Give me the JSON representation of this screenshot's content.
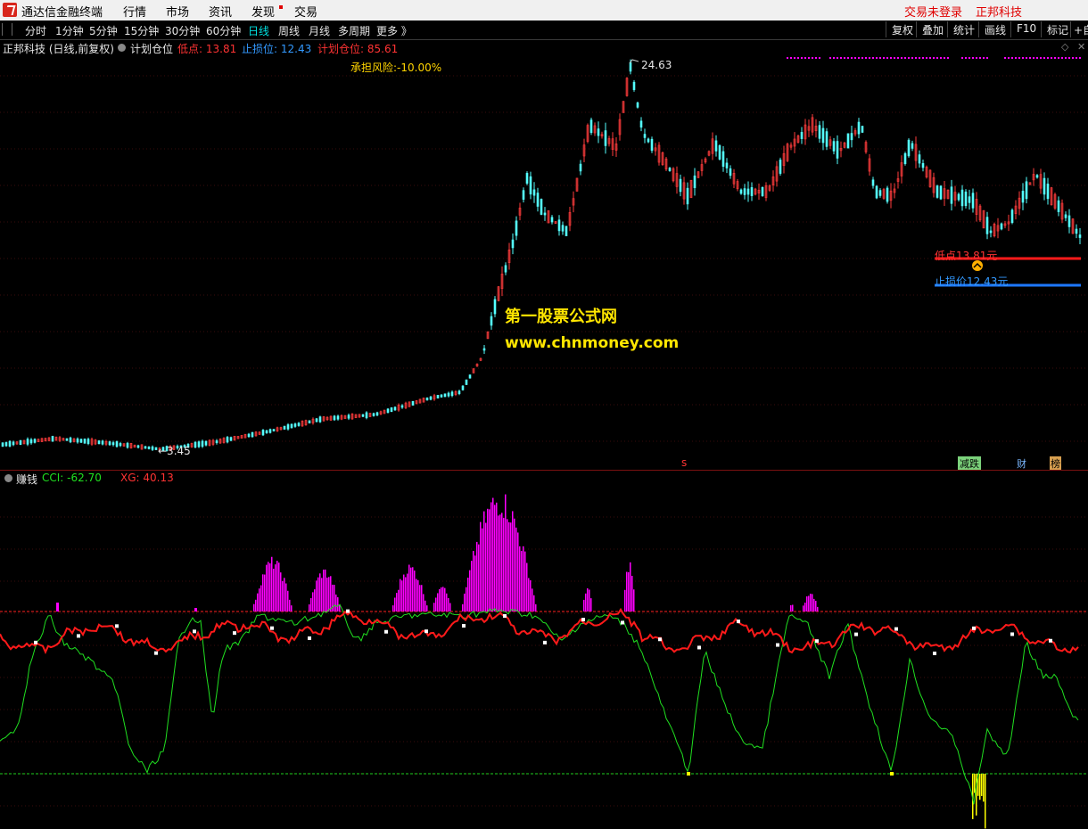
{
  "menubar": {
    "app_title": "通达信金融终端",
    "items": [
      "行情",
      "市场",
      "资讯",
      "发现",
      "交易"
    ],
    "trade_status": "交易未登录",
    "stock_name": "正邦科技"
  },
  "periodbar": {
    "periods": [
      "分时",
      "1分钟",
      "5分钟",
      "15分钟",
      "30分钟",
      "60分钟",
      "日线",
      "周线",
      "月线",
      "多周期",
      "更多 》"
    ],
    "active": "日线",
    "tools": [
      "复权",
      "叠加",
      "统计",
      "画线",
      "F10",
      "标记",
      "+自"
    ]
  },
  "main_panel": {
    "title": "正邦科技 (日线,前复权)",
    "indicator": "计划仓位",
    "low_label": "低点: 13.81",
    "stop_label": "止损位: 12.43",
    "plan_label": "计划仓位: 85.61",
    "risk_label": "承担风险:-10.00%",
    "high_marker": "24.63",
    "low_marker": "←3.45",
    "low_line_label": "低点13.81元",
    "stop_line_label": "止损价12.43元",
    "watermark_cn": "第一股票公式网",
    "watermark_url": "www.chnmoney.com",
    "s_marker": "s",
    "badge_down": "减跌",
    "badge_fin": "财",
    "badge_rank": "榜"
  },
  "sub_panel": {
    "indicator": "赚钱",
    "cci_label": "CCI: -62.70",
    "xg_label": "XG: 40.13"
  },
  "colors": {
    "up": "#ff3c3c",
    "down": "#54ffff",
    "cci": "#20e020",
    "xg": "#ff1a1a",
    "bars": "#ff00ff",
    "yellow_bars": "#ffff00",
    "stop_line": "#1e78ff"
  }
}
